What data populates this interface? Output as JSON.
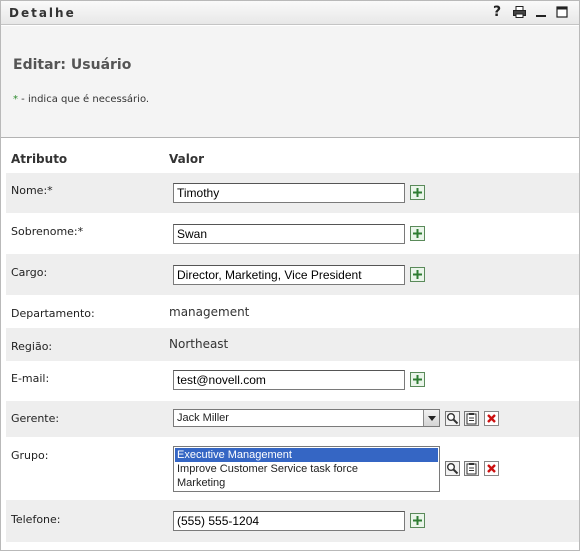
{
  "window": {
    "title": "Detalhe"
  },
  "titlebar": {
    "icons": [
      "help-icon",
      "print-icon",
      "minimize-icon",
      "maximize-icon"
    ]
  },
  "page": {
    "title": "Editar: Usuário",
    "required_marker": "*",
    "required_note": " - indica que é necessário."
  },
  "columns": {
    "attribute": "Atributo",
    "value": "Valor"
  },
  "fields": {
    "nome": {
      "label": "Nome:*",
      "value": "Timothy"
    },
    "sobrenome": {
      "label": "Sobrenome:*",
      "value": "Swan"
    },
    "cargo": {
      "label": "Cargo:",
      "value": "Director, Marketing, Vice President"
    },
    "departamento": {
      "label": "Departamento:",
      "value": "management"
    },
    "regiao": {
      "label": "Região:",
      "value": "Northeast"
    },
    "email": {
      "label": "E-mail:",
      "value": "test@novell.com"
    },
    "gerente": {
      "label": "Gerente:",
      "value": "Jack Miller"
    },
    "grupo": {
      "label": "Grupo:",
      "options": [
        "Executive Management",
        "Improve Customer Service task force",
        "Marketing"
      ],
      "selected": "Executive Management"
    },
    "telefone": {
      "label": "Telefone:",
      "value": "(555) 555-1204"
    }
  },
  "colors": {
    "row_alt": "#eeeeee",
    "header_bg": "#f4f4f4",
    "selection": "#3566c4",
    "add_green": "#2e7d32",
    "delete_red": "#cc1111"
  }
}
